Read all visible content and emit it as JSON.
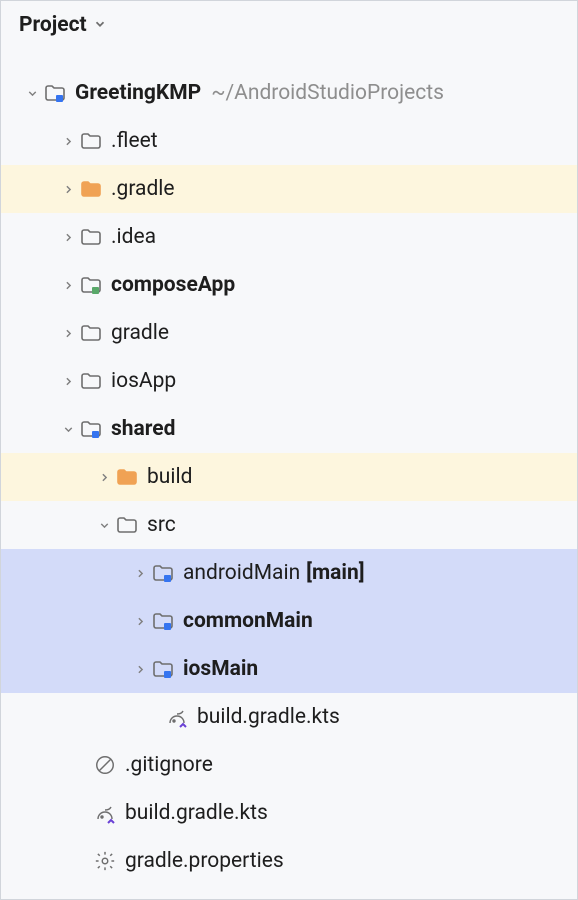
{
  "header": {
    "title": "Project"
  },
  "tree": {
    "root": {
      "label": "GreetingKMP",
      "annotation": "~/AndroidStudioProjects"
    },
    "items": [
      {
        "label": ".fleet"
      },
      {
        "label": ".gradle"
      },
      {
        "label": ".idea"
      },
      {
        "label": "composeApp"
      },
      {
        "label": "gradle"
      },
      {
        "label": "iosApp"
      },
      {
        "label": "shared"
      },
      {
        "label": "build"
      },
      {
        "label": "src"
      },
      {
        "label": "androidMain",
        "annotation": "[main]"
      },
      {
        "label": "commonMain"
      },
      {
        "label": "iosMain"
      },
      {
        "label": "build.gradle.kts"
      },
      {
        "label": ".gitignore"
      },
      {
        "label": "build.gradle.kts"
      },
      {
        "label": "gradle.properties"
      }
    ]
  }
}
